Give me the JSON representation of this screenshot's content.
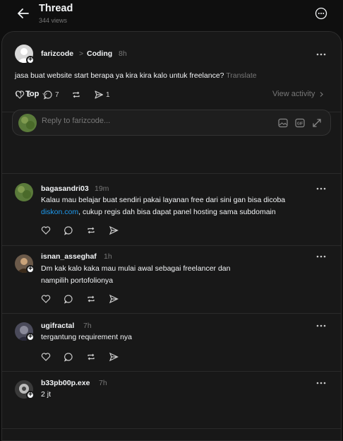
{
  "header": {
    "title": "Thread",
    "views": "344 views",
    "back_icon": "back-arrow-icon",
    "more_icon": "more-circle-icon"
  },
  "post": {
    "username": "farizcode",
    "separator": ">",
    "topic": "Coding",
    "time": "8h",
    "text": "jasa buat website start berapa ya kira kira kalo untuk freelance?",
    "translate": "Translate",
    "likes": "1",
    "comments": "7",
    "shares": "1"
  },
  "sort": {
    "label": "Top",
    "view_activity": "View activity"
  },
  "reply_box": {
    "placeholder": "Reply to farizcode..."
  },
  "replies": [
    {
      "username": "bagasandri03",
      "time": "19m",
      "text_before": "Kalau mau belajar buat sendiri pakai layanan free dari sini gan bisa dicoba",
      "link": "diskon.com",
      "text_after": ", cukup regis dah bisa dapat panel hosting sama subdomain",
      "avatar_color": "#5a7a3a"
    },
    {
      "username": "isnan_asseghaf",
      "time": "1h",
      "text": "Dm kak kalo kaka mau mulai awal sebagai freelancer dan nampilih portofolionya",
      "text_line1": "Dm kak kalo kaka mau mulai awal sebagai freelancer dan",
      "text_line2": "nampilih portofolionya",
      "avatar_color": "#6b5a4a"
    },
    {
      "username": "ugifractal",
      "time": "7h",
      "text": "tergantung requirement nya",
      "avatar_color": "#4a4a5a"
    },
    {
      "username": "b33pb00p.exe",
      "time": "7h",
      "text": "2 jt",
      "avatar_color": "#3a3a3a"
    }
  ],
  "colors": {
    "background": "#0f0f0f",
    "panel": "#181818",
    "link": "#1d9bf0",
    "muted": "#777777"
  }
}
